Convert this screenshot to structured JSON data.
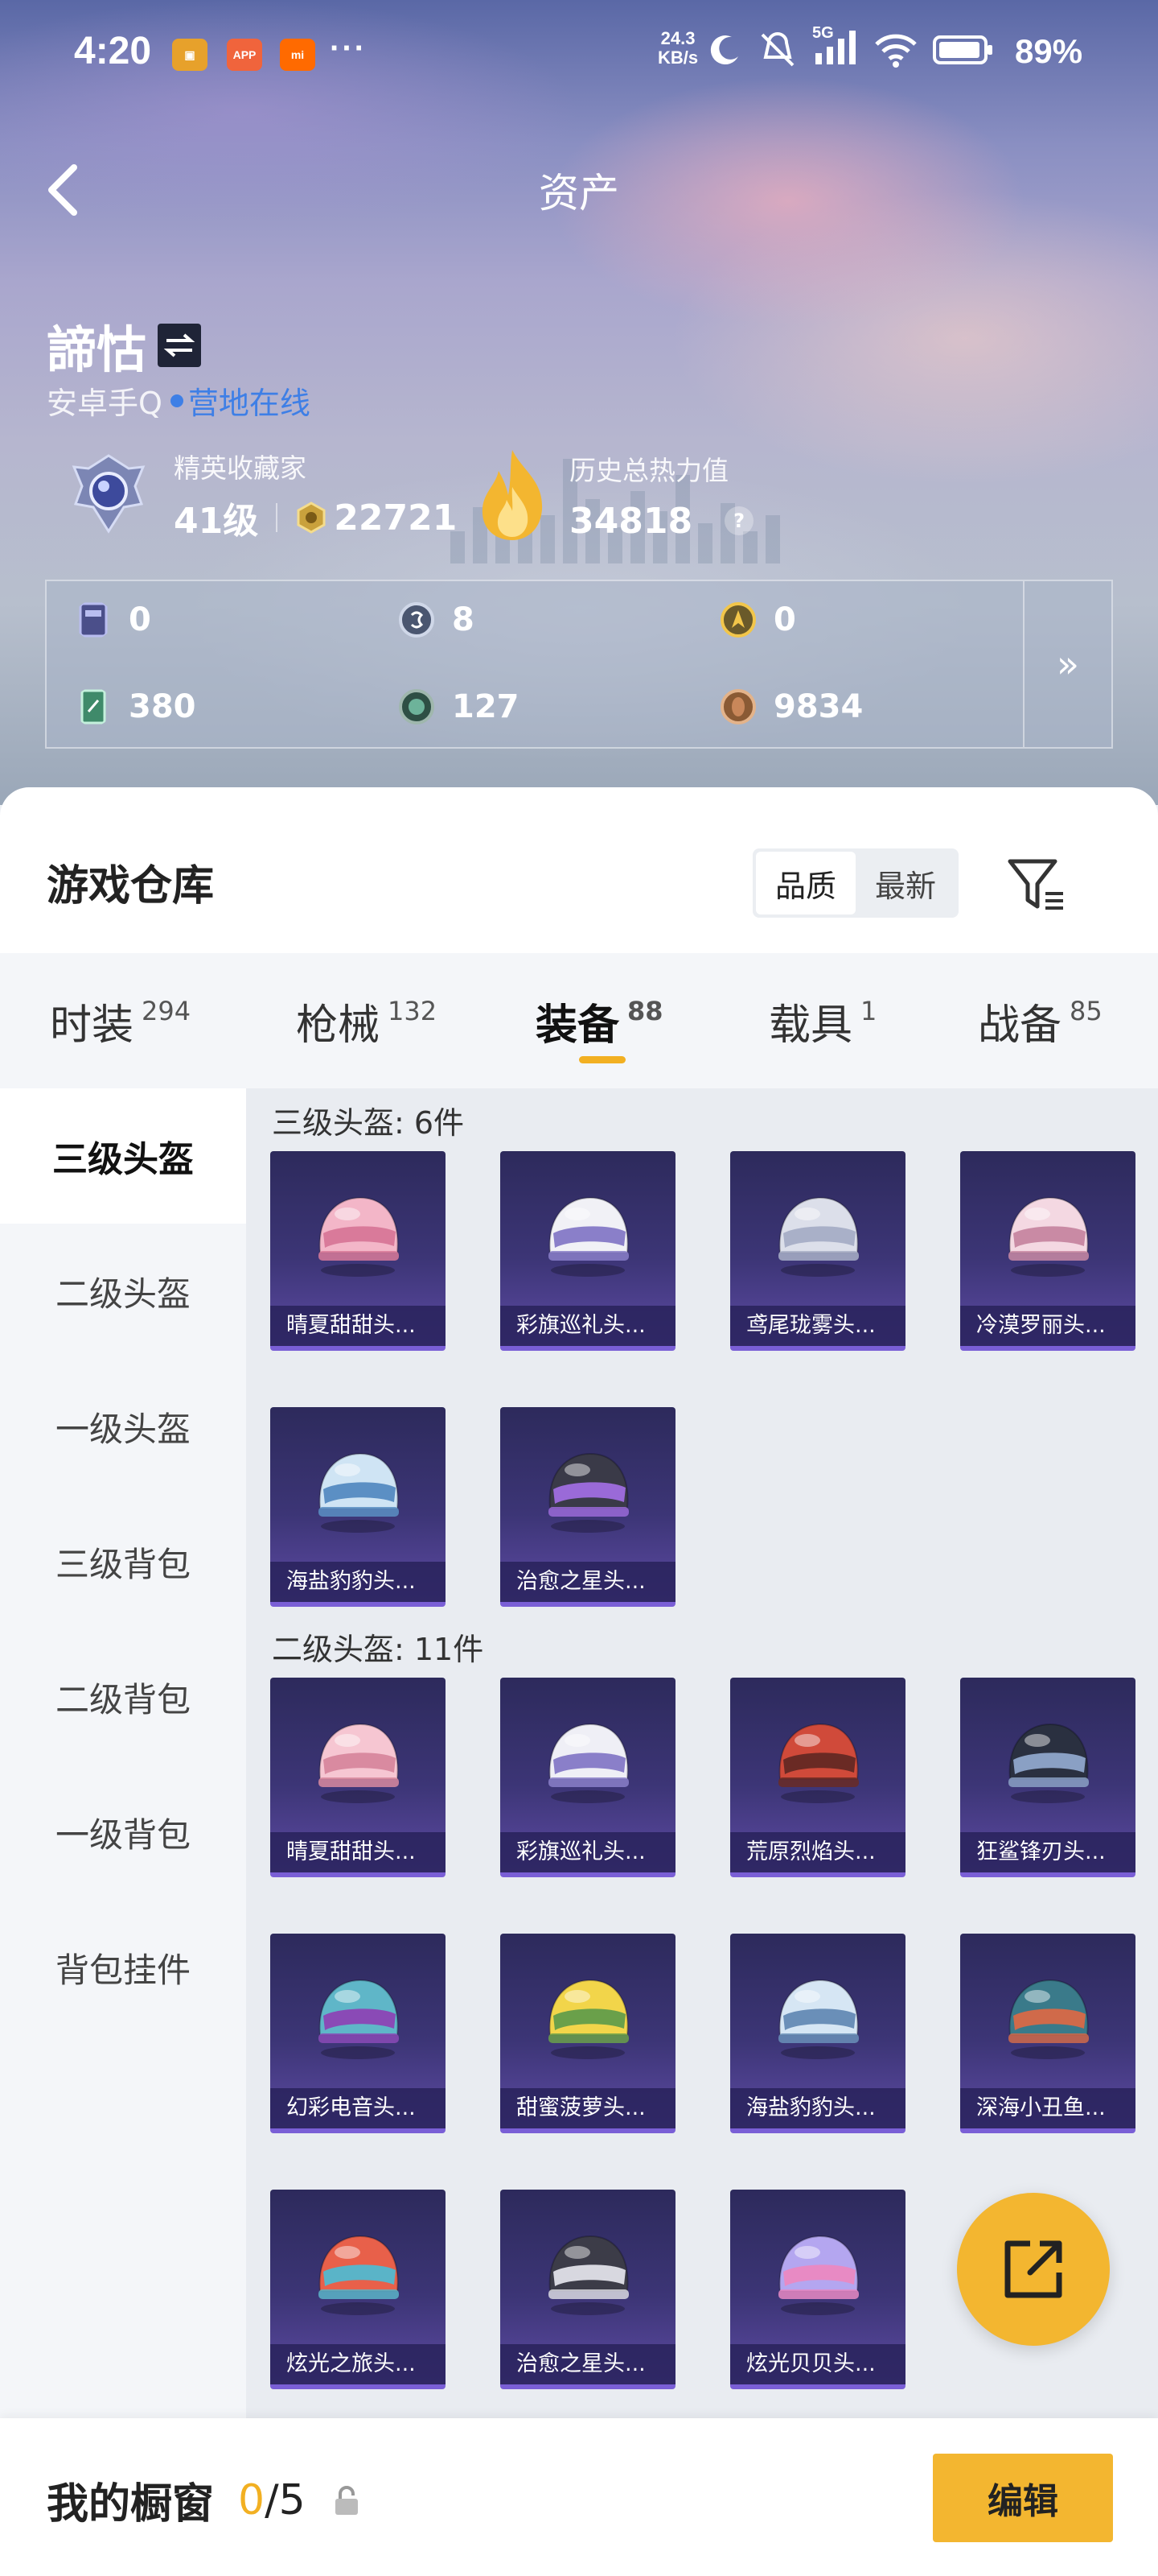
{
  "status_bar": {
    "time": "4:20",
    "net_speed_value": "24.3",
    "net_speed_unit": "KB/s",
    "network": "5G",
    "battery": "89%"
  },
  "nav": {
    "title": "资产"
  },
  "user": {
    "name": "諦怙",
    "platform": "安卓手Q",
    "status": "营地在线"
  },
  "rank": {
    "title": "精英收藏家",
    "level": "41级",
    "points": "22721"
  },
  "heat": {
    "title": "历史总热力值",
    "value": "34818"
  },
  "currencies": [
    {
      "icon": "card-icon",
      "value": "0",
      "color": "#4b4f8a"
    },
    {
      "icon": "silver-coin-icon",
      "value": "8",
      "color": "#4a5670"
    },
    {
      "icon": "gold-badge-icon",
      "value": "0",
      "color": "#6a5a2a"
    },
    {
      "icon": "green-ticket-icon",
      "value": "380",
      "color": "#3f8a6a"
    },
    {
      "icon": "green-orb-icon",
      "value": "127",
      "color": "#2e4f44"
    },
    {
      "icon": "bronze-coin-icon",
      "value": "9834",
      "color": "#8a5a34"
    }
  ],
  "warehouse": {
    "title": "游戏仓库",
    "sort_options": [
      "品质",
      "最新"
    ],
    "tabs": [
      {
        "label": "时装",
        "count": "294"
      },
      {
        "label": "枪械",
        "count": "132"
      },
      {
        "label": "装备",
        "count": "88"
      },
      {
        "label": "载具",
        "count": "1"
      },
      {
        "label": "战备",
        "count": "85"
      }
    ],
    "side_items": [
      "三级头盔",
      "二级头盔",
      "一级头盔",
      "三级背包",
      "二级背包",
      "一级背包",
      "背包挂件"
    ],
    "sections": [
      {
        "title": "三级头盔: 6件",
        "items": [
          "晴夏甜甜头...",
          "彩旗巡礼头...",
          "鸢尾珑雾头...",
          "冷漠罗丽头...",
          "海盐豹豹头...",
          "治愈之星头..."
        ]
      },
      {
        "title": "二级头盔: 11件",
        "items": [
          "晴夏甜甜头...",
          "彩旗巡礼头...",
          "荒原烈焰头...",
          "狂鲨锋刃头...",
          "幻彩电音头...",
          "甜蜜菠萝头...",
          "海盐豹豹头...",
          "深海小丑鱼...",
          "炫光之旅头...",
          "治愈之星头...",
          "炫光贝贝头..."
        ]
      }
    ]
  },
  "showcase": {
    "title": "我的橱窗",
    "current": "0",
    "total": "/5",
    "edit_label": "编辑"
  },
  "colors": {
    "accent": "#f3b630",
    "online": "#3e7fe6",
    "item_bg": "#3c3576"
  }
}
